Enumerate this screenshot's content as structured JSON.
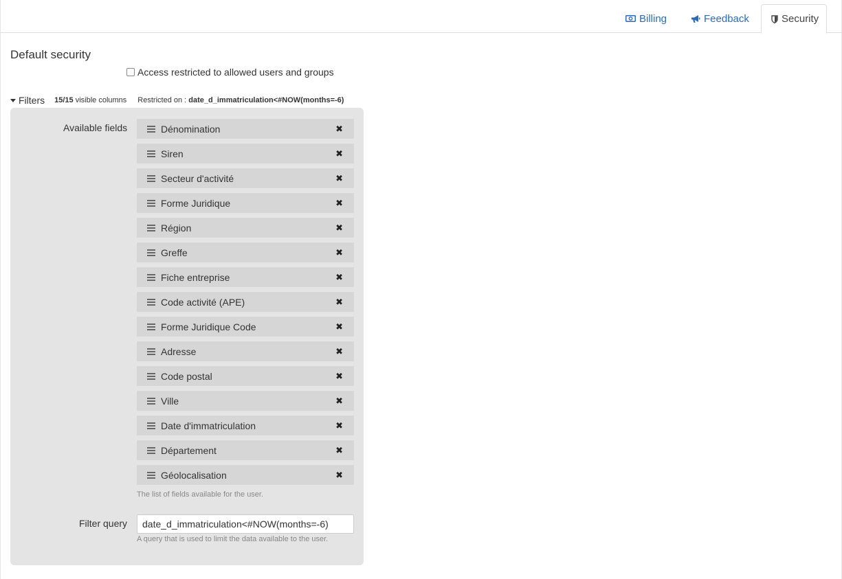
{
  "tabs": [
    {
      "label": "Billing",
      "icon": "money-icon"
    },
    {
      "label": "Feedback",
      "icon": "bullhorn-icon"
    },
    {
      "label": "Security",
      "icon": "shield-icon",
      "active": true
    }
  ],
  "security": {
    "title": "Default security",
    "restrict_label": "Access restricted to allowed users and groups",
    "restrict_checked": false
  },
  "filters": {
    "toggle_label": "Filters",
    "visible_count": "15/15",
    "visible_suffix": " visible columns",
    "restricted_prefix": "Restricted on : ",
    "restricted_value": "date_d_immatriculation<#NOW(months=-6)"
  },
  "panel": {
    "available_label": "Available fields",
    "fields": [
      "Dénomination",
      "Siren",
      "Secteur d'activité",
      "Forme Juridique",
      "Région",
      "Greffe",
      "Fiche entreprise",
      "Code activité (APE)",
      "Forme Juridique Code",
      "Adresse",
      "Code postal",
      "Ville",
      "Date d'immatriculation",
      "Département",
      "Géolocalisation"
    ],
    "fields_help": "The list of fields available for the user.",
    "query_label": "Filter query",
    "query_value": "date_d_immatriculation<#NOW(months=-6)",
    "query_help": "A query that is used to limit the data available to the user."
  },
  "colors": {
    "link": "#2a6bbf",
    "panel_bg": "#e4e4e4",
    "field_bg": "#d6d6d6"
  }
}
